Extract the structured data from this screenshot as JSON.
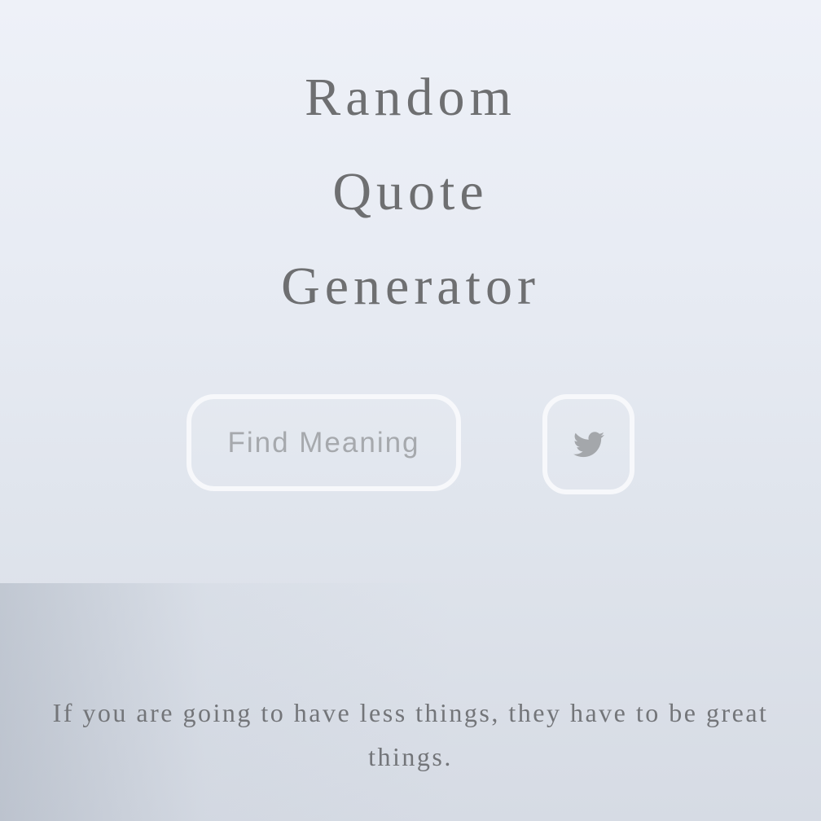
{
  "header": {
    "title_lines": [
      "Random",
      "Quote",
      "Generator"
    ]
  },
  "actions": {
    "find_label": "Find Meaning",
    "tweet_icon": "twitter-bird-icon",
    "tweet_icon_color": "#a4a7ab"
  },
  "quote": {
    "text": "If you are going to have less things, they have to be great things."
  },
  "colors": {
    "background_top": "#eef1f8",
    "background_bottom": "#d6dbe4",
    "title_text": "#6e6f71",
    "button_border": "#f7f8fb",
    "button_text": "#a6a9ad",
    "quote_text": "#737579"
  }
}
